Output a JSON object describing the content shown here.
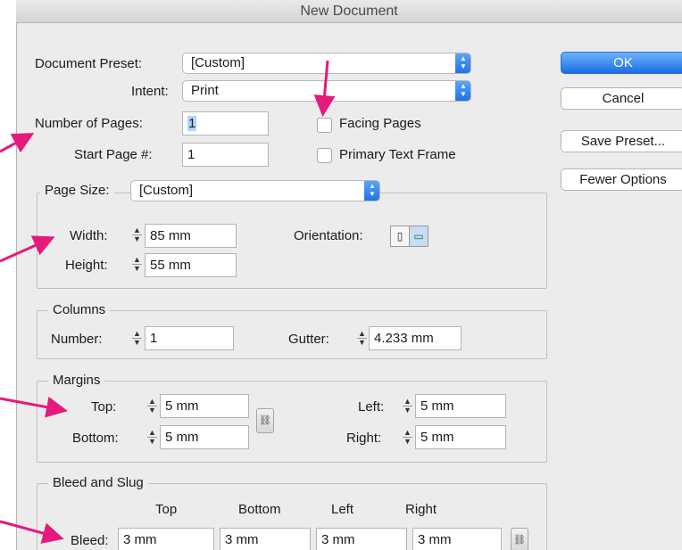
{
  "window": {
    "title": "New Document"
  },
  "document": {
    "preset_label": "Document Preset:",
    "preset_value": "[Custom]",
    "intent_label": "Intent:",
    "intent_value": "Print",
    "pages_label": "Number of Pages:",
    "pages_value": "1",
    "start_label": "Start Page #:",
    "start_value": "1",
    "facing_label": "Facing Pages",
    "primary_label": "Primary Text Frame",
    "facing_checked": false,
    "primary_checked": false
  },
  "buttons": {
    "ok": "OK",
    "cancel": "Cancel",
    "save_preset": "Save Preset...",
    "fewer_options": "Fewer Options"
  },
  "page_size": {
    "label": "Page Size:",
    "value": "[Custom]",
    "width_label": "Width:",
    "width_value": "85 mm",
    "height_label": "Height:",
    "height_value": "55 mm",
    "orientation_label": "Orientation:"
  },
  "columns": {
    "title": "Columns",
    "number_label": "Number:",
    "number_value": "1",
    "gutter_label": "Gutter:",
    "gutter_value": "4.233 mm"
  },
  "margins": {
    "title": "Margins",
    "top_label": "Top:",
    "top_value": "5 mm",
    "bottom_label": "Bottom:",
    "bottom_value": "5 mm",
    "left_label": "Left:",
    "left_value": "5 mm",
    "right_label": "Right:",
    "right_value": "5 mm"
  },
  "bleed": {
    "title": "Bleed and Slug",
    "col_top": "Top",
    "col_bottom": "Bottom",
    "col_left": "Left",
    "col_right": "Right",
    "row_label": "Bleed:",
    "top": "3 mm",
    "bottom": "3 mm",
    "left": "3 mm",
    "right": "3 mm"
  },
  "colors": {
    "accent": "#2a7ef0",
    "annotation": "#e6197d",
    "dialog_bg": "#ececec"
  },
  "icons": {
    "stepper": "up-down-chevron-icon",
    "spinner": "up-down-arrow-icon",
    "link": "chain-link-icon",
    "portrait": "portrait-orientation-icon",
    "landscape": "landscape-orientation-icon",
    "annotation": "magenta-arrow-icon"
  }
}
